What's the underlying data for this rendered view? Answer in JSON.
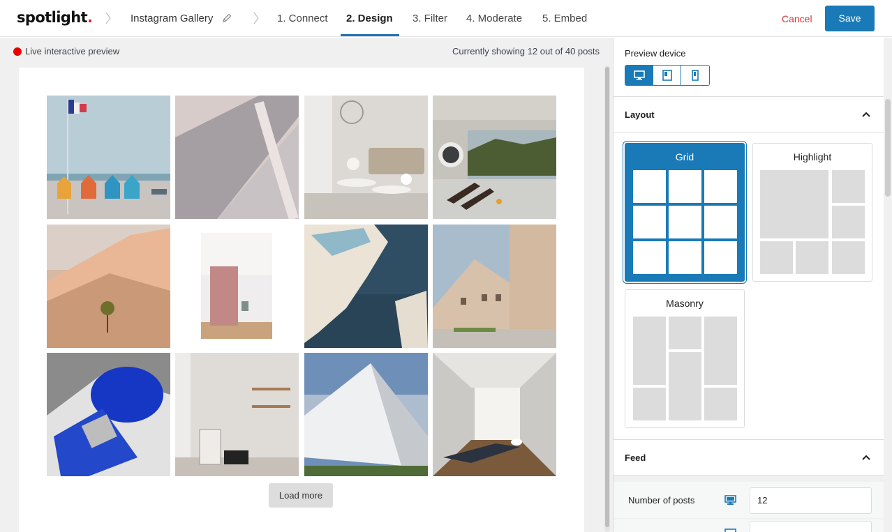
{
  "header": {
    "logo_text": "spotlight",
    "logo_dot": ".",
    "gallery_name": "Instagram Gallery",
    "steps": [
      {
        "label": "1. Connect",
        "active": false
      },
      {
        "label": "2. Design",
        "active": true
      },
      {
        "label": "3. Filter",
        "active": false
      },
      {
        "label": "4. Moderate",
        "active": false
      },
      {
        "label": "5. Embed",
        "active": false
      }
    ],
    "cancel_label": "Cancel",
    "save_label": "Save"
  },
  "preview": {
    "live_label": "Live interactive preview",
    "showing_text": "Currently showing 12 out of 40 posts",
    "load_more_label": "Load more"
  },
  "sidebar": {
    "preview_device_label": "Preview device",
    "devices": [
      "desktop",
      "tablet",
      "phone"
    ],
    "selected_device": "desktop",
    "layout": {
      "title": "Layout",
      "options": [
        {
          "label": "Grid",
          "selected": true
        },
        {
          "label": "Highlight",
          "selected": false
        },
        {
          "label": "Masonry",
          "selected": false
        }
      ]
    },
    "feed": {
      "title": "Feed",
      "number_of_posts_label": "Number of posts",
      "number_of_posts_value": "12"
    }
  },
  "colors": {
    "accent": "#1a7ab8",
    "cancel": "#d63638",
    "live_dot": "#e80000"
  }
}
